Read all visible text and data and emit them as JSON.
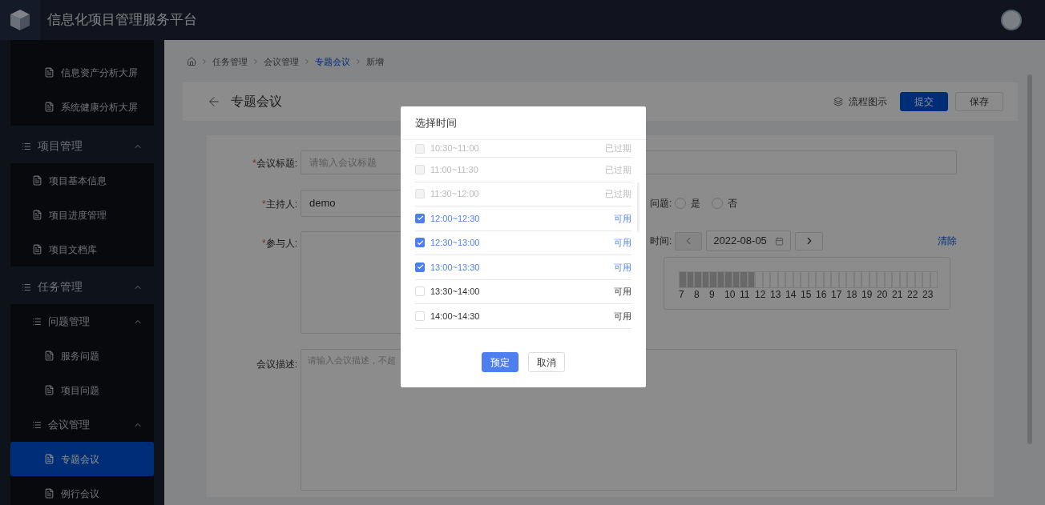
{
  "header": {
    "title": "信息化项目管理服务平台"
  },
  "sidebar": {
    "items": [
      {
        "kind": "group",
        "children": [
          {
            "kind": "group",
            "children": [
              {
                "label": "信息资产分析大屏",
                "kind": "page",
                "selected": false
              },
              {
                "label": "系统健康分析大屏",
                "kind": "page",
                "selected": false
              }
            ]
          }
        ]
      },
      {
        "label": "项目管理",
        "kind": "group",
        "expanded": true,
        "children": [
          {
            "label": "项目基本信息",
            "kind": "page",
            "selected": false
          },
          {
            "label": "项目进度管理",
            "kind": "page",
            "selected": false
          },
          {
            "label": "项目文档库",
            "kind": "page",
            "selected": false
          }
        ]
      },
      {
        "label": "任务管理",
        "kind": "group",
        "expanded": true,
        "children": [
          {
            "label": "问题管理",
            "kind": "group",
            "expanded": true,
            "children": [
              {
                "label": "服务问题",
                "kind": "page",
                "selected": false
              },
              {
                "label": "项目问题",
                "kind": "page",
                "selected": false
              }
            ]
          },
          {
            "label": "会议管理",
            "kind": "group",
            "expanded": true,
            "children": [
              {
                "label": "专题会议",
                "kind": "page",
                "selected": true
              },
              {
                "label": "例行会议",
                "kind": "page",
                "selected": false
              }
            ]
          }
        ]
      }
    ]
  },
  "breadcrumb": [
    {
      "label": "任务管理",
      "kind": "text"
    },
    {
      "label": "会议管理",
      "kind": "text"
    },
    {
      "label": "专题会议",
      "kind": "link"
    },
    {
      "label": "新增",
      "kind": "text"
    }
  ],
  "page_header": {
    "title": "专题会议",
    "flow_link": "流程图示",
    "buttons": [
      {
        "label": "提交",
        "kind": "primary"
      },
      {
        "label": "保存",
        "kind": "default"
      }
    ]
  },
  "form": {
    "title_field": {
      "label": "会议标题:",
      "required_mark": "*",
      "placeholder": "请输入会议标题"
    },
    "host_field": {
      "label": "主持人:",
      "required_mark": "*",
      "value": "demo"
    },
    "participants_field": {
      "label": "参与人:",
      "required_mark": "*"
    },
    "issue_field": {
      "label": "问题:",
      "options": [
        {
          "label": "是",
          "selected": false
        },
        {
          "label": "否",
          "selected": false
        }
      ]
    },
    "time_field": {
      "label": "时间:",
      "date": "2022-08-05",
      "clear": "清除",
      "hours": [
        "7",
        "8",
        "9",
        "10",
        "11",
        "12",
        "13",
        "14",
        "15",
        "16",
        "17",
        "18",
        "19",
        "20",
        "21",
        "22",
        "23"
      ],
      "slots": [
        {
          "past": true
        },
        {
          "past": true
        },
        {
          "past": true
        },
        {
          "past": true
        },
        {
          "past": true
        },
        {
          "past": true
        },
        {
          "past": true
        },
        {
          "past": true
        },
        {
          "past": true
        },
        {
          "past": true
        },
        {
          "past": false
        },
        {
          "past": false
        },
        {
          "past": false
        },
        {
          "past": false
        },
        {
          "past": false
        },
        {
          "past": false
        },
        {
          "past": false
        },
        {
          "past": false
        },
        {
          "past": false
        },
        {
          "past": false
        },
        {
          "past": false
        },
        {
          "past": false
        },
        {
          "past": false
        },
        {
          "past": false
        },
        {
          "past": false
        },
        {
          "past": false
        },
        {
          "past": false
        },
        {
          "past": false
        },
        {
          "past": false
        },
        {
          "past": false
        },
        {
          "past": false
        },
        {
          "past": false
        },
        {
          "past": false
        },
        {
          "past": false
        }
      ]
    },
    "description_field": {
      "label": "会议描述:",
      "placeholder": "请输入会议描述，不超"
    }
  },
  "dialog": {
    "title": "选择时间",
    "slots": [
      {
        "time": "10:30~11:00",
        "status": "已过期",
        "checked": false,
        "disabled": true
      },
      {
        "time": "11:00~11:30",
        "status": "已过期",
        "checked": false,
        "disabled": true
      },
      {
        "time": "11:30~12:00",
        "status": "已过期",
        "checked": false,
        "disabled": true
      },
      {
        "time": "12:00~12:30",
        "status": "可用",
        "checked": true,
        "disabled": false
      },
      {
        "time": "12:30~13:00",
        "status": "可用",
        "checked": true,
        "disabled": false
      },
      {
        "time": "13:00~13:30",
        "status": "可用",
        "checked": true,
        "disabled": false
      },
      {
        "time": "13:30~14:00",
        "status": "可用",
        "checked": false,
        "disabled": false
      },
      {
        "time": "14:00~14:30",
        "status": "可用",
        "checked": false,
        "disabled": false
      }
    ],
    "buttons": [
      {
        "label": "预定",
        "kind": "primary"
      },
      {
        "label": "取消",
        "kind": "default"
      }
    ]
  }
}
